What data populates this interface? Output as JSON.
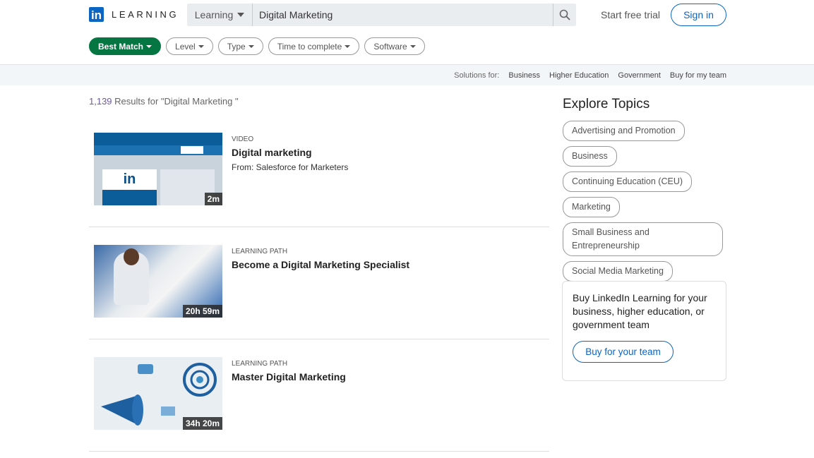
{
  "header": {
    "logo_mark": "in",
    "logo_text": "LEARNING",
    "search_category": "Learning",
    "search_value": "Digital Marketing",
    "trial": "Start free trial",
    "signin": "Sign in"
  },
  "filters": [
    "Best Match",
    "Level",
    "Type",
    "Time to complete",
    "Software"
  ],
  "solutions": {
    "label": "Solutions for:",
    "links": [
      "Business",
      "Higher Education",
      "Government",
      "Buy for my team"
    ]
  },
  "results": {
    "count": "1,139",
    "suffix": " Results for \"Digital Marketing \"",
    "items": [
      {
        "type": "VIDEO",
        "title": "Digital marketing",
        "from": "From: Salesforce for Marketers",
        "duration": "2m"
      },
      {
        "type": "LEARNING PATH",
        "title": "Become a Digital Marketing Specialist",
        "duration": "20h 59m"
      },
      {
        "type": "LEARNING PATH",
        "title": "Master Digital Marketing",
        "duration": "34h 20m"
      }
    ]
  },
  "sidebar": {
    "title": "Explore Topics",
    "topics": [
      "Advertising and Promotion",
      "Business",
      "Continuing Education (CEU)",
      "Marketing",
      "Small Business and Entrepreneurship",
      "Social Media Marketing"
    ],
    "buy_text": "Buy LinkedIn Learning for your business, higher education, or government team",
    "buy_button": "Buy for your team"
  },
  "colors": {
    "brand": "#0a66c2",
    "active_filter": "#057642"
  }
}
